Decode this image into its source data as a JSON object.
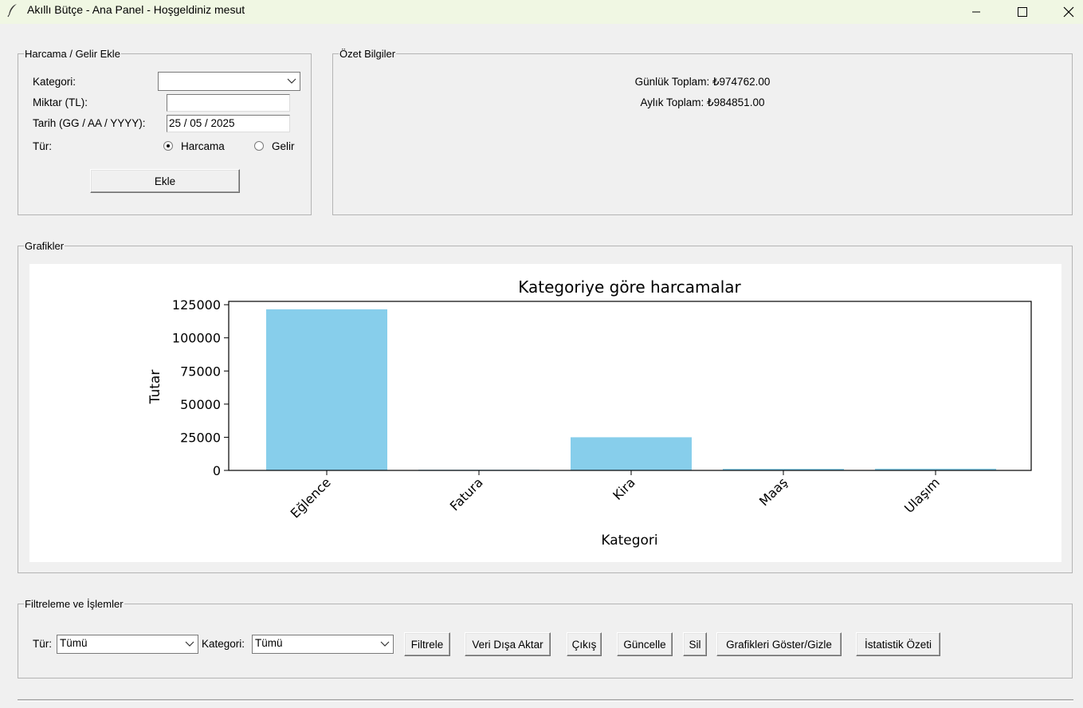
{
  "window": {
    "title": "Akıllı Bütçe - Ana Panel - Hoşgeldiniz mesut",
    "icon": "feather-icon"
  },
  "add_panel": {
    "legend": "Harcama / Gelir Ekle",
    "category_label": "Kategori:",
    "category_value": "",
    "amount_label": "Miktar (TL):",
    "amount_value": "",
    "date_label": "Tarih (GG / AA / YYYY):",
    "date_value": "25 / 05 / 2025",
    "type_label": "Tür:",
    "radio_expense": "Harcama",
    "radio_income": "Gelir",
    "selected_type": "Harcama",
    "add_button": "Ekle"
  },
  "summary_panel": {
    "legend": "Özet Bilgiler",
    "daily_total": "Günlük Toplam: ₺974762.00",
    "monthly_total": "Aylık Toplam: ₺984851.00"
  },
  "charts_panel": {
    "legend": "Grafikler"
  },
  "chart_data": {
    "type": "bar",
    "title": "Kategoriye göre harcamalar",
    "xlabel": "Kategori",
    "ylabel": "Tutar",
    "categories": [
      "Eğlence",
      "Fatura",
      "Kira",
      "Maaş",
      "Ulaşım"
    ],
    "values": [
      121500,
      500,
      25000,
      1200,
      1300
    ],
    "ylim": [
      0,
      127500
    ],
    "yticks": [
      0,
      25000,
      50000,
      75000,
      100000,
      125000
    ],
    "ytick_labels": [
      "0",
      "25000",
      "50000",
      "75000",
      "100000",
      "125000"
    ],
    "bar_color": "#87ceeb",
    "grid": false
  },
  "filter_panel": {
    "legend": "Filtreleme ve İşlemler",
    "type_label": "Tür:",
    "type_value": "Tümü",
    "category_label": "Kategori:",
    "category_value": "Tümü",
    "buttons": {
      "filter": "Filtrele",
      "export": "Veri Dışa Aktar",
      "exit": "Çıkış",
      "update": "Güncelle",
      "delete": "Sil",
      "toggle_charts": "Grafikleri Göster/Gizle",
      "stats": "İstatistik Özeti"
    }
  }
}
